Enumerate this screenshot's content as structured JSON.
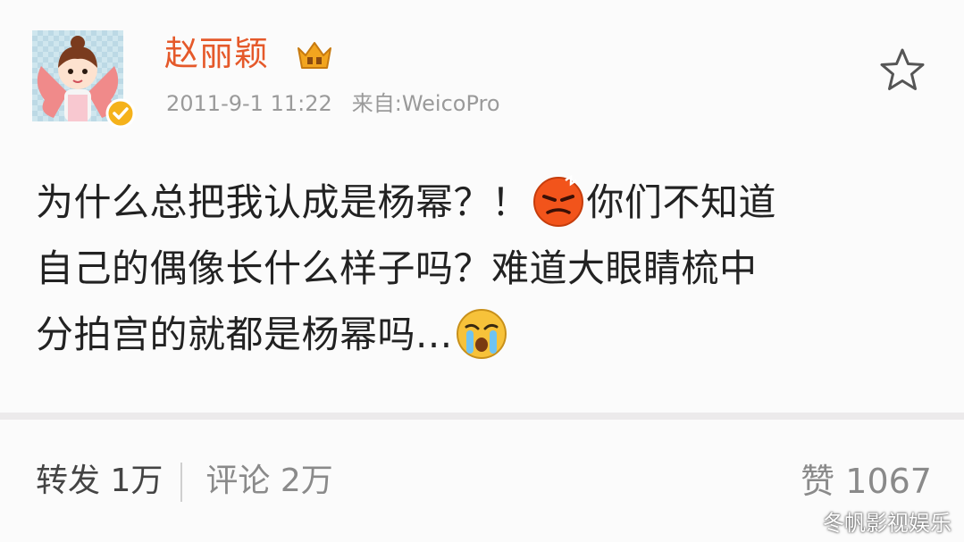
{
  "post": {
    "username": "赵丽颖",
    "timestamp": "2011-9-1 11:22",
    "source": "来自:WeicoPro",
    "content": {
      "line1_a": "为什么总把我认成是杨幂？！",
      "line1_b": "你们不知道",
      "line2": "自己的偶像长什么样子吗？难道大眼睛梳中",
      "line3": "分拍宫的就都是杨幂吗...",
      "emoji_1": "angry-face-icon",
      "emoji_2": "crying-face-icon"
    }
  },
  "actions": {
    "repost_label": "转发",
    "repost_count": "1万",
    "comment_label": "评论",
    "comment_count": "2万",
    "like_label": "赞",
    "like_count": "1067"
  },
  "watermark": "冬帆影视娱乐",
  "colors": {
    "username": "#e5592a",
    "meta": "#9a9a9a",
    "text": "#222222",
    "verified": "#f5b21b"
  }
}
